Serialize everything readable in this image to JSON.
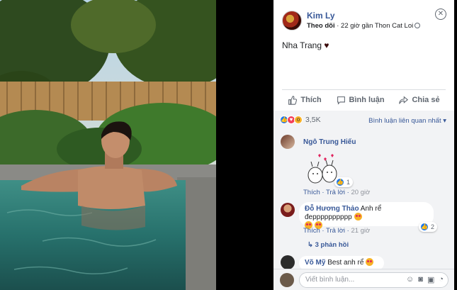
{
  "post": {
    "author": "Kim Ly",
    "follow": "Theo dõi",
    "sep": " · ",
    "time_location": "22 giờ gần Thon Cat Loi",
    "close": "✕",
    "text": "Nha Trang",
    "text_emoji": "♥"
  },
  "actions": {
    "like": "Thích",
    "comment": "Bình luận",
    "share": "Chia sẻ"
  },
  "stats": {
    "reaction_count": "3,5K",
    "sort_label": "Bình luận liên quan nhất ▾"
  },
  "comments": [
    {
      "author": "Ngô Trung Hiếu",
      "text": "",
      "like_label": "Thích",
      "reply_label": "Trả lời",
      "time": "20 giờ",
      "reaction_count": "1"
    },
    {
      "author": "Đỗ Hương Thảo",
      "text": "Anh rể đepppppppppp",
      "like_label": "Thích",
      "reply_label": "Trả lời",
      "time": "21 giờ",
      "reaction_count": "2",
      "replies_label": "3 phản hồi"
    },
    {
      "author": "Võ Mỹ",
      "text": "Best anh rể"
    }
  ],
  "composer": {
    "placeholder": "Viết bình luận..."
  },
  "icons": {
    "like": "like-icon",
    "comment": "comment-icon",
    "share": "share-icon",
    "globe": "globe-icon",
    "close": "close-icon"
  },
  "colors": {
    "link": "#385898",
    "like_blue": "#1877f2",
    "love_red": "#f33e58",
    "wow_yellow": "#f7b125"
  }
}
